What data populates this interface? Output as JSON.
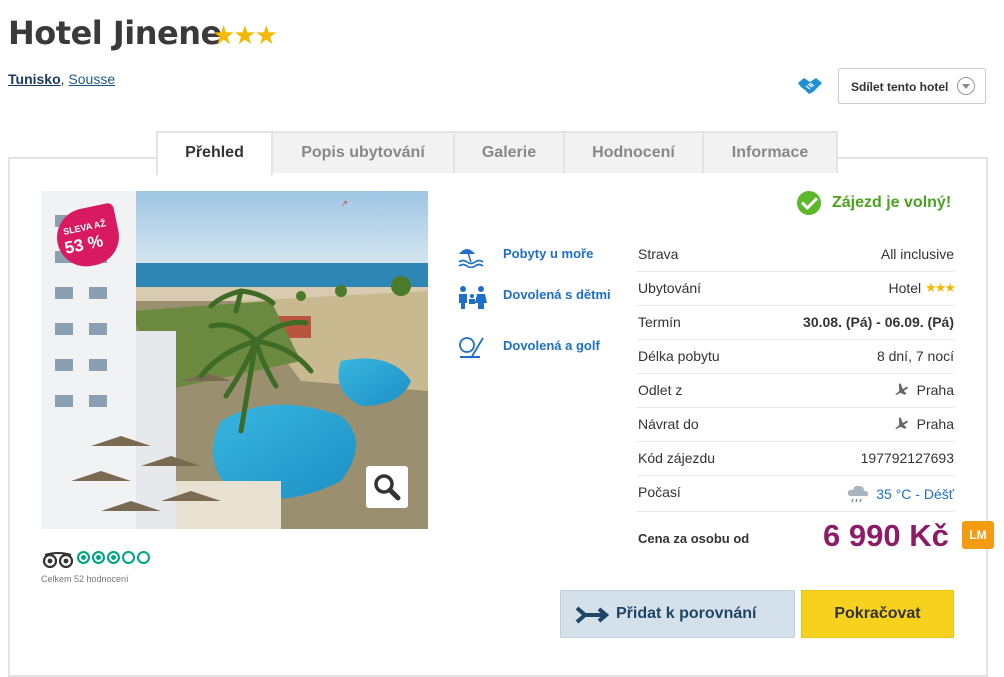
{
  "hotel": {
    "name": "Hotel Jinene",
    "stars": "★★★",
    "country": "Tunisko",
    "separator": ",",
    "city": "Sousse"
  },
  "share": {
    "label": "Sdílet tento hotel"
  },
  "tabs": [
    {
      "label": "Přehled",
      "active": true
    },
    {
      "label": "Popis ubytování"
    },
    {
      "label": "Galerie"
    },
    {
      "label": "Hodnocení"
    },
    {
      "label": "Informace"
    }
  ],
  "discount": {
    "line1": "SLEVA AŽ",
    "line2": "53 %"
  },
  "tripadvisor": {
    "rating_filled": 3,
    "rating_max": 5,
    "count_text": "Celkem 52 hodnocení"
  },
  "categories": [
    {
      "label": "Pobyty u moře",
      "icon": "beach-icon"
    },
    {
      "label": "Dovolená s dětmi",
      "icon": "family-icon"
    },
    {
      "label": "Dovolená a golf",
      "icon": "golf-icon"
    }
  ],
  "availability": "Zájezd je volný!",
  "details": [
    {
      "key": "Strava",
      "value": "All inclusive"
    },
    {
      "key": "Ubytování",
      "value": "Hotel",
      "stars": "★★★"
    },
    {
      "key": "Termín",
      "value": "30.08. (Pá) - 06.09. (Pá)"
    },
    {
      "key": "Délka pobytu",
      "value": "8 dní, 7 nocí"
    },
    {
      "key": "Odlet z",
      "value": "Praha"
    },
    {
      "key": "Návrat do",
      "value": "Praha"
    },
    {
      "key": "Kód zájezdu",
      "value": "197792127693"
    },
    {
      "key": "Počasí",
      "value": "35 °C - Déšť"
    }
  ],
  "price": {
    "label": "Cena za osobu od",
    "value": "6 990 Kč",
    "badge": "LM"
  },
  "buttons": {
    "compare": "Přidat k porovnání",
    "continue": "Pokračovat"
  },
  "colors": {
    "accent_blue": "#1d6fc9",
    "price": "#8e1b67",
    "available": "#4aa31f",
    "cta": "#f6d21f",
    "badge": "#d81b60"
  }
}
